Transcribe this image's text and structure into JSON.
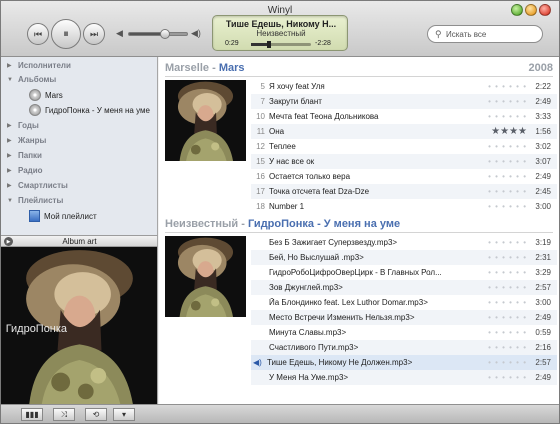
{
  "window": {
    "title": "Winyl"
  },
  "player": {
    "prev_icon": "⏮",
    "play_icon": "⏸",
    "next_icon": "⏭",
    "now_playing_title": "Тише Едешь, Никому Н...",
    "now_playing_artist": "Неизвестный",
    "elapsed": "0:29",
    "remaining": "-2:28",
    "progress": 0.3,
    "volume": 0.6
  },
  "search": {
    "placeholder": "Искать все"
  },
  "sidebar": {
    "artists": "Исполнители",
    "albums": "Альбомы",
    "album_items": [
      "Mars",
      "ГидроПонка - У меня на уме"
    ],
    "years": "Годы",
    "genres": "Жанры",
    "folders": "Папки",
    "radio": "Радио",
    "smartlists": "Смартлисты",
    "playlists": "Плейлисты",
    "playlist_items": [
      "Мой плейлист"
    ]
  },
  "album_art": {
    "title": "Album art"
  },
  "groups": [
    {
      "artist": "Marselle",
      "album": "Mars",
      "year": "2008",
      "tracks": [
        {
          "num": "5",
          "title": "Я хочу feat Уля",
          "dur": "2:22",
          "rating": 0
        },
        {
          "num": "7",
          "title": "Закрути блант",
          "dur": "2:49",
          "rating": 0
        },
        {
          "num": "10",
          "title": "Мечта feat Теона Дольникова",
          "dur": "3:33",
          "rating": 0
        },
        {
          "num": "11",
          "title": "Она",
          "dur": "1:56",
          "rating": 4
        },
        {
          "num": "12",
          "title": "Теплее",
          "dur": "3:02",
          "rating": 0
        },
        {
          "num": "15",
          "title": "У нас все ок",
          "dur": "3:07",
          "rating": 0
        },
        {
          "num": "16",
          "title": "Остается только вера",
          "dur": "2:49",
          "rating": 0
        },
        {
          "num": "17",
          "title": "Точка отсчета feat Dza-Dze",
          "dur": "2:45",
          "rating": 0
        },
        {
          "num": "18",
          "title": "Number 1",
          "dur": "3:00",
          "rating": 0
        }
      ]
    },
    {
      "artist": "Неизвестный",
      "album": "ГидроПонка - У меня на уме",
      "year": "",
      "tracks": [
        {
          "num": "",
          "title": "Без Б Зажигает Суперзвезду.mp3>",
          "dur": "3:19",
          "rating": 0
        },
        {
          "num": "",
          "title": "Бей, Но Выслушай .mp3>",
          "dur": "2:31",
          "rating": 0
        },
        {
          "num": "",
          "title": "ГидроРобоЦифроОверЦирк - В Главных Рол...",
          "dur": "3:29",
          "rating": 0
        },
        {
          "num": "",
          "title": "Зов Джунглей.mp3>",
          "dur": "2:57",
          "rating": 0
        },
        {
          "num": "",
          "title": "Йа Блондинко feat. Lex Luthor  Domar.mp3>",
          "dur": "3:00",
          "rating": 0
        },
        {
          "num": "",
          "title": "Место Встречи Изменить Нельзя.mp3>",
          "dur": "2:49",
          "rating": 0
        },
        {
          "num": "",
          "title": "Минута Славы.mp3>",
          "dur": "0:59",
          "rating": 0
        },
        {
          "num": "",
          "title": "Счастливого Пути.mp3>",
          "dur": "2:16",
          "rating": 0
        },
        {
          "num": "",
          "title": "Тише Едешь, Никому Не Должен.mp3>",
          "dur": "2:57",
          "rating": 0,
          "playing": true
        },
        {
          "num": "",
          "title": "У Меня На Уме.mp3>",
          "dur": "2:49",
          "rating": 0
        }
      ]
    }
  ],
  "cover": {
    "text": "ГидроПонка"
  },
  "bottom": {
    "icons": [
      "equalizer-icon",
      "shuffle-icon",
      "repeat-icon",
      "menu-icon"
    ]
  }
}
